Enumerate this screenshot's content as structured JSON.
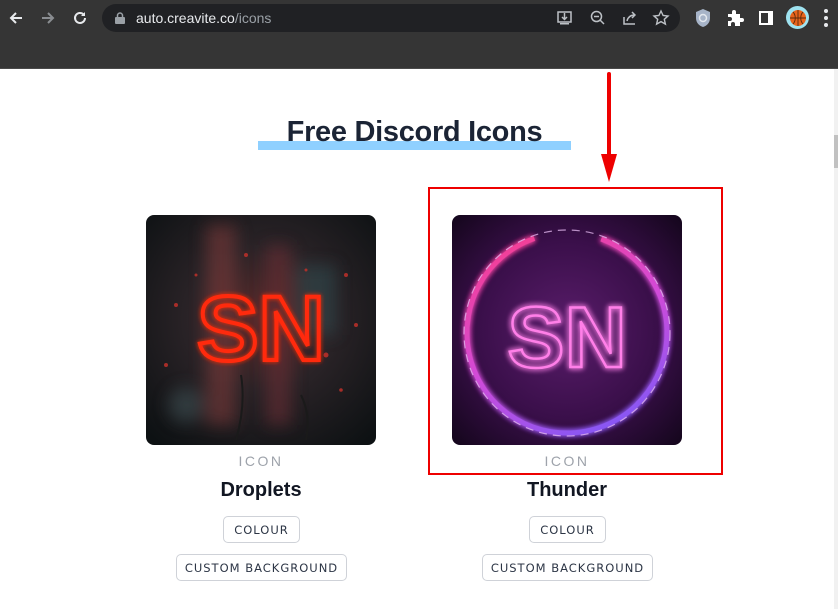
{
  "browser": {
    "url_domain": "auto.creavite.co",
    "url_path": "/icons",
    "nav": {
      "back": "back-arrow",
      "forward": "forward-arrow",
      "reload": "reload"
    },
    "omnibox_icons": [
      "install-app",
      "zoom-out",
      "share",
      "bookmark-star"
    ],
    "extension_icons": [
      "shield-extension",
      "extensions-puzzle",
      "side-panel",
      "profile-avatar",
      "menu-dots"
    ]
  },
  "page": {
    "title": "Free Discord Icons",
    "accent_color": "#8fd0ff",
    "annotation_color": "#ee0000",
    "cards": [
      {
        "type_label": "ICON",
        "name": "Droplets",
        "image_text": "SN",
        "image_description": "red neon SN letters behind rain droplets",
        "buttons": [
          "COLOUR",
          "CUSTOM BACKGROUND"
        ]
      },
      {
        "type_label": "ICON",
        "name": "Thunder",
        "image_text": "SN",
        "image_description": "pink neon SN letters inside purple lightning ring",
        "buttons": [
          "COLOUR",
          "CUSTOM BACKGROUND"
        ],
        "highlighted": true
      }
    ]
  }
}
